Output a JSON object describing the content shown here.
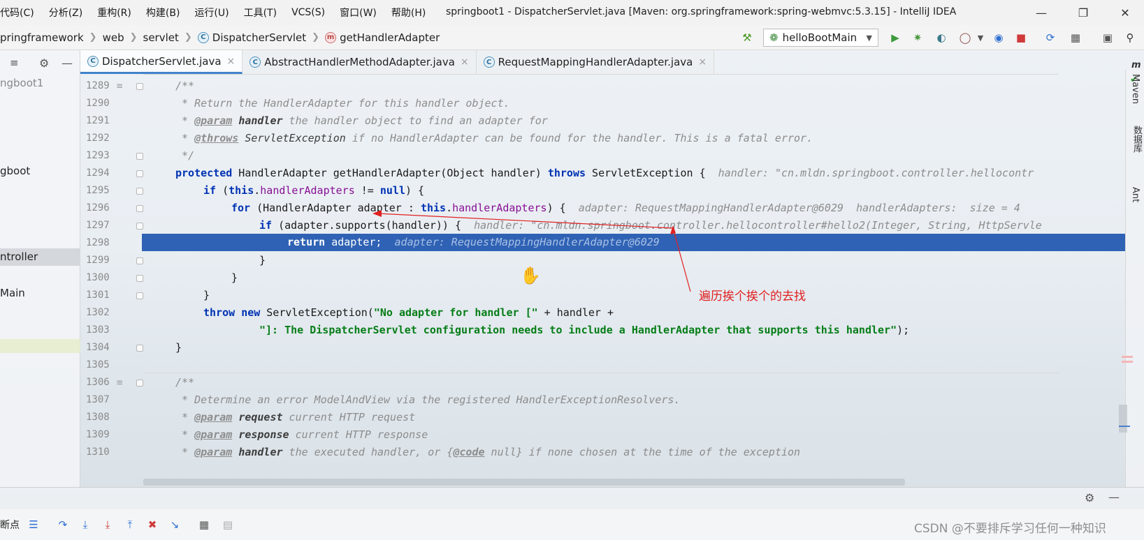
{
  "menu": {
    "items": [
      "代码(C)",
      "分析(Z)",
      "重构(R)",
      "构建(B)",
      "运行(U)",
      "工具(T)",
      "VCS(S)",
      "窗口(W)",
      "帮助(H)"
    ],
    "window_title": "springboot1 - DispatcherServlet.java [Maven: org.springframework:spring-webmvc:5.3.15] - IntelliJ IDEA"
  },
  "breadcrumb": [
    "pringframework",
    "web",
    "servlet",
    "DispatcherServlet",
    "getHandlerAdapter"
  ],
  "toolbar": {
    "run_config": "helloBootMain"
  },
  "left_panel": {
    "items": [
      "ngboot1",
      "gboot",
      "ntroller",
      "Main"
    ]
  },
  "tabs": [
    {
      "label": "DispatcherServlet.java",
      "active": true
    },
    {
      "label": "AbstractHandlerMethodAdapter.java",
      "active": false
    },
    {
      "label": "RequestMappingHandlerAdapter.java",
      "active": false
    }
  ],
  "editor": {
    "line_numbers": [
      "1289",
      "1290",
      "1291",
      "1292",
      "1293",
      "1294",
      "1295",
      "1296",
      "1297",
      "1298",
      "1299",
      "1300",
      "1301",
      "1302",
      "1303",
      "1304",
      "1305",
      "1306",
      "1307",
      "1308",
      "1309",
      "1310"
    ],
    "lines": {
      "l1289": "/**",
      "l1290": " * Return the HandlerAdapter for this handler object.",
      "l1291_tag": "@param",
      "l1291_id": "handler",
      "l1291_rest": " the handler object to find an adapter for",
      "l1292_tag": "@throws",
      "l1292_id": "ServletException",
      "l1292_rest": " if no HandlerAdapter can be found for the handler. This is a fatal error.",
      "l1293": " */",
      "l1294_kw1": "protected",
      "l1294_mid": " HandlerAdapter getHandlerAdapter(Object handler) ",
      "l1294_kw2": "throws",
      "l1294_end": " ServletException {",
      "l1294_hint": "handler: \"cn.mldn.springboot.controller.hellocontr",
      "l1295_kw": "if",
      "l1295_a": " (",
      "l1295_this": "this",
      "l1295_dot": ".",
      "l1295_fld": "handlerAdapters",
      "l1295_b": " != ",
      "l1295_null": "null",
      "l1295_c": ") {",
      "l1296_kw": "for",
      "l1296_a": " (HandlerAdapter adapter : ",
      "l1296_this": "this",
      "l1296_dot": ".",
      "l1296_fld": "handlerAdapters",
      "l1296_b": ") {",
      "l1296_hint": "adapter: RequestMappingHandlerAdapter@6029  handlerAdapters:  size = 4",
      "l1297_kw": "if",
      "l1297_a": " (adapter.supports(handler)) {",
      "l1297_hint": "handler: \"cn.mldn.springboot.controller.hellocontroller#hello2(Integer, String, HttpServle",
      "l1298_kw": "return",
      "l1298_a": " adapter;",
      "l1298_hint": "adapter: RequestMappingHandlerAdapter@6029",
      "l1299": "}",
      "l1300": "}",
      "l1301": "}",
      "l1302_kw1": "throw",
      "l1302_kw2": "new",
      "l1302_a": " ServletException(",
      "l1302_str": "\"No adapter for handler [\"",
      "l1302_b": " + handler +",
      "l1303_str": "\"]: The DispatcherServlet configuration needs to include a HandlerAdapter that supports this handler\"",
      "l1303_b": ");",
      "l1304": "}",
      "l1306": "/**",
      "l1307": " * Determine an error ModelAndView via the registered HandlerExceptionResolvers.",
      "l1308_tag": "@param",
      "l1308_id": "request",
      "l1308_rest": " current HTTP request",
      "l1309_tag": "@param",
      "l1309_id": "response",
      "l1309_rest": " current HTTP response",
      "l1310_tag": "@param",
      "l1310_id": "handler",
      "l1310_rest_a": " the executed handler, or {",
      "l1310_code": "@code",
      "l1310_rest_b": " null} if none chosen at the time of the exception"
    }
  },
  "annotation": {
    "text": "遍历挨个挨个的去找",
    "color": "#e02020"
  },
  "right_strip": {
    "labels": [
      "Maven",
      "数据库",
      "Ant"
    ]
  },
  "debug": {
    "label": "断点"
  },
  "watermark": "CSDN @不要排斥学习任何一种知识",
  "colors": {
    "highlight": "#2f62b4",
    "keyword": "#0033b3",
    "field": "#871094",
    "string": "#067d17",
    "comment": "#8c8c8c"
  }
}
